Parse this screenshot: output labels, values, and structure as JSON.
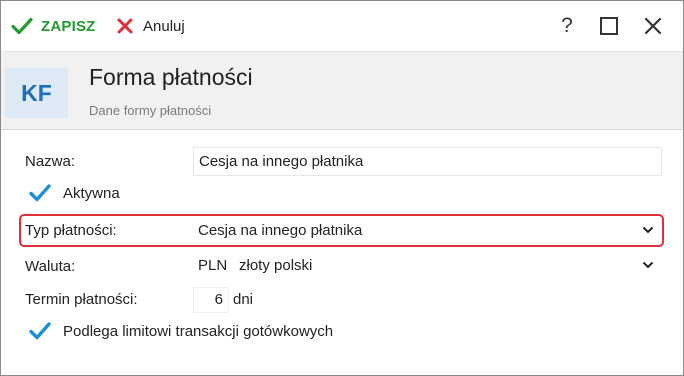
{
  "toolbar": {
    "save_label": "ZAPISZ",
    "cancel_label": "Anuluj",
    "help_label": "?"
  },
  "header": {
    "badge": "KF",
    "title": "Forma płatności",
    "subtitle": "Dane formy płatności"
  },
  "form": {
    "name_label": "Nazwa:",
    "name_value": "Cesja na innego płatnika",
    "active_label": "Aktywna",
    "active_checked": true,
    "payment_type_label": "Typ płatności:",
    "payment_type_value": "Cesja na innego płatnika",
    "currency_label": "Waluta:",
    "currency_code": "PLN",
    "currency_name": "złoty polski",
    "term_label": "Termin płatności:",
    "term_value": "6",
    "term_unit": "dni",
    "cash_limit_label": "Podlega limitowi transakcji gotówkowych",
    "cash_limit_checked": true
  },
  "colors": {
    "save": "#1f9b2f",
    "cancel": "#e0303a",
    "checkmark": "#1b8fd8",
    "badge_text": "#1d6fb8",
    "highlight": "#e0303a"
  }
}
